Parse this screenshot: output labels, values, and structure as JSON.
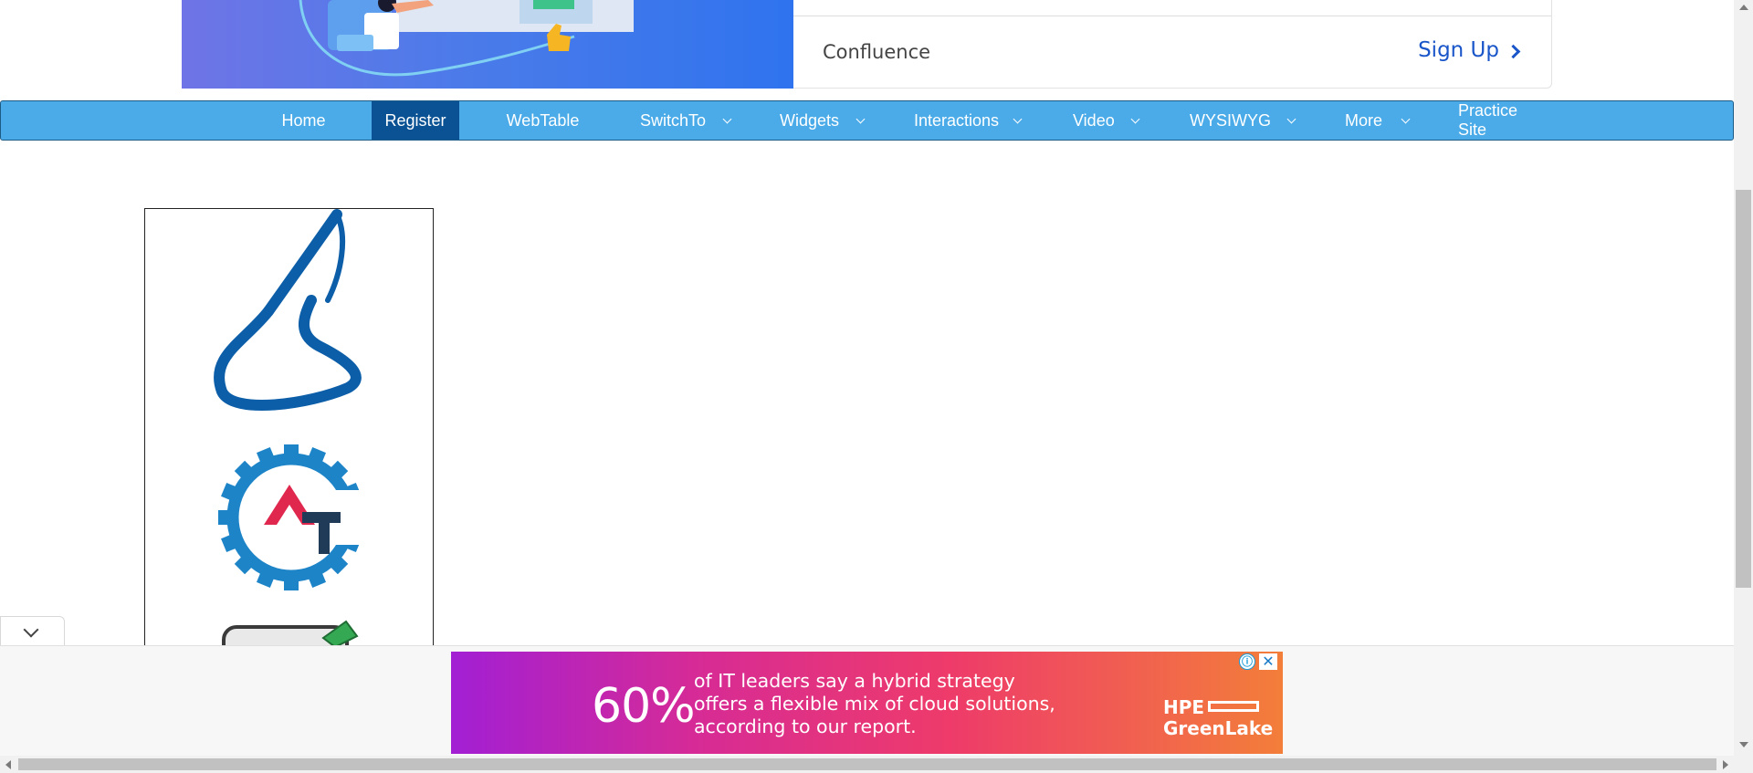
{
  "top_ad": {
    "brand": "Confluence",
    "cta": "Sign Up"
  },
  "nav": {
    "items": [
      {
        "label": "Home",
        "dropdown": false,
        "active": false
      },
      {
        "label": "Register",
        "dropdown": false,
        "active": true
      },
      {
        "label": "WebTable",
        "dropdown": false,
        "active": false
      },
      {
        "label": "SwitchTo",
        "dropdown": true,
        "active": false
      },
      {
        "label": "Widgets",
        "dropdown": true,
        "active": false
      },
      {
        "label": "Interactions",
        "dropdown": true,
        "active": false
      },
      {
        "label": "Video",
        "dropdown": true,
        "active": false
      },
      {
        "label": "WYSIWYG",
        "dropdown": true,
        "active": false
      },
      {
        "label": "More",
        "dropdown": true,
        "active": false
      },
      {
        "label": "Practice Site",
        "dropdown": false,
        "active": false
      }
    ]
  },
  "logos": [
    "s-logo",
    "at-gear-logo",
    "partial-logo"
  ],
  "bottom_ad": {
    "percent": "60%",
    "lines": [
      "of IT leaders say a hybrid strategy",
      "offers a flexible mix of cloud solutions,",
      "according to our report."
    ],
    "brand_top": "HPE",
    "brand_bottom": "GreenLake",
    "info_icon": "ⓘ",
    "close_icon": "✕"
  },
  "colors": {
    "nav_bg": "#4aabe8",
    "nav_active": "#0a5294",
    "cta": "#1a56c9"
  }
}
